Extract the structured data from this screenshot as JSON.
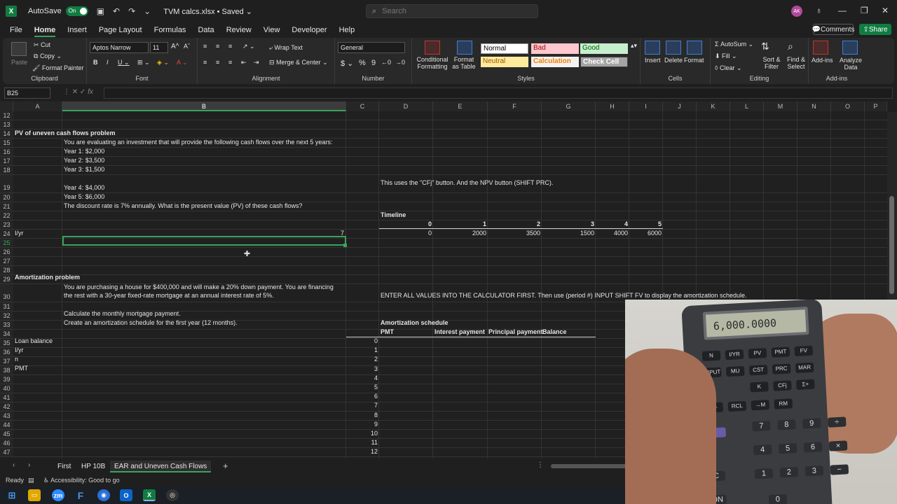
{
  "titlebar": {
    "autosave": "AutoSave",
    "toggle": "On",
    "filename": "TVM calcs.xlsx",
    "saved": "Saved",
    "search_placeholder": "Search",
    "avatar": "AK"
  },
  "menu": [
    "File",
    "Home",
    "Insert",
    "Page Layout",
    "Formulas",
    "Data",
    "Review",
    "View",
    "Developer",
    "Help"
  ],
  "menu_active": "Home",
  "comments": "Comments",
  "share": "Share",
  "ribbon": {
    "clipboard": {
      "label": "Clipboard",
      "paste": "Paste",
      "cut": "Cut",
      "copy": "Copy",
      "format_painter": "Format Painter"
    },
    "font": {
      "label": "Font",
      "family": "Aptos Narrow",
      "size": "11"
    },
    "alignment": {
      "label": "Alignment",
      "wrap": "Wrap Text",
      "merge": "Merge & Center"
    },
    "number": {
      "label": "Number",
      "format": "General"
    },
    "styles": {
      "label": "Styles",
      "cond": "Conditional Formatting",
      "table": "Format as Table",
      "cells": [
        {
          "name": "Normal",
          "bg": "#ffffff",
          "fg": "#000000"
        },
        {
          "name": "Bad",
          "bg": "#ffc7ce",
          "fg": "#9c0006"
        },
        {
          "name": "Good",
          "bg": "#c6efce",
          "fg": "#006100"
        },
        {
          "name": "Neutral",
          "bg": "#ffeb9c",
          "fg": "#9c5700"
        },
        {
          "name": "Calculation",
          "bg": "#f2f2f2",
          "fg": "#fa7d00"
        },
        {
          "name": "Check Cell",
          "bg": "#a5a5a5",
          "fg": "#ffffff"
        }
      ]
    },
    "cells": {
      "label": "Cells",
      "insert": "Insert",
      "delete": "Delete",
      "format": "Format"
    },
    "editing": {
      "label": "Editing",
      "autosum": "AutoSum",
      "fill": "Fill",
      "clear": "Clear",
      "sort": "Sort & Filter",
      "find": "Find & Select"
    },
    "addins": {
      "label": "Add-ins",
      "addins": "Add-ins",
      "analyze": "Analyze Data"
    }
  },
  "namebox": "B25",
  "columns": [
    "A",
    "B",
    "C",
    "D",
    "E",
    "F",
    "G",
    "H",
    "I",
    "J",
    "K",
    "L",
    "M",
    "N",
    "O",
    "P"
  ],
  "rows": [
    "12",
    "13",
    "14",
    "15",
    "16",
    "17",
    "18",
    "19",
    "20",
    "21",
    "22",
    "23",
    "24",
    "25",
    "26",
    "27",
    "28",
    "29",
    "30",
    "31",
    "32",
    "33",
    "34",
    "35",
    "36",
    "37",
    "38",
    "39",
    "40",
    "41",
    "42",
    "43",
    "44",
    "45",
    "46",
    "47"
  ],
  "cells": {
    "r14a": "PV of uneven cash flows problem",
    "r15b": "You are evaluating an investment that will provide the following cash flows over the next 5 years:",
    "r16b": "Year 1: $2,000",
    "r17b": "Year 2: $3,500",
    "r18b": "Year 3: $1,500",
    "r19b": "Year 4: $4,000",
    "r19d": "This uses the \"CFj\" button. And the NPV button (SHIFT PRC).",
    "r20b": "Year 5: $6,000",
    "r21b": "The discount rate is 7% annually. What is the present value (PV) of these cash flows?",
    "r22d": "Timeline",
    "r23_timeline": [
      "0",
      "1",
      "2",
      "3",
      "4",
      "5"
    ],
    "r24a": "I/yr",
    "r24b": "7",
    "r24_cash": [
      "0",
      "2000",
      "3500",
      "1500",
      "4000",
      "6000"
    ],
    "r29a": "Amortization problem",
    "r30b1": "You are purchasing a house for $400,000 and will make a 20% down payment. You are financing",
    "r30b2": "the rest with a 30-year fixed-rate mortgage at an annual interest rate of 5%.",
    "r30d": "ENTER ALL VALUES INTO THE CALCULATOR FIRST. Then use (period #) INPUT SHIFT FV to display the amortization schedule.",
    "r32b": "Calculate the monthly mortgage payment.",
    "r33b": "Create an amortization schedule for the first year (12 months).",
    "r33d": "Amortization schedule",
    "r34d": "PMT",
    "r34e": "Interest payment",
    "r34f": "Principal payment",
    "r34g": "Balance",
    "r35a": "Loan balance",
    "r36a": "I/yr",
    "r37a": "n",
    "r38a": "PMT",
    "schedule_periods": [
      "0",
      "1",
      "2",
      "3",
      "4",
      "5",
      "6",
      "7",
      "8",
      "9",
      "10",
      "11",
      "12"
    ]
  },
  "sheets": [
    "First",
    "HP 10B",
    "EAR and Uneven Cash Flows"
  ],
  "active_sheet": "EAR and Uneven Cash Flows",
  "status": {
    "ready": "Ready",
    "accessibility": "Accessibility: Good to go"
  },
  "calculator": {
    "display": "6,000.0000",
    "keys_row1": [
      "N",
      "I/YR",
      "PV",
      "PMT",
      "FV"
    ],
    "keys_row2": [
      "INPUT",
      "MU",
      "CST",
      "PRC",
      "MAR"
    ],
    "keys_row3": [
      "K",
      "CFj",
      "Σ+"
    ],
    "keys_row4": [
      "+/-",
      "RCL",
      "→M",
      "RM"
    ],
    "digits": [
      "7",
      "8",
      "9",
      "÷",
      "4",
      "5",
      "6",
      "×",
      "1",
      "2",
      "3",
      "−"
    ],
    "c_key": "C",
    "on_key": "ON",
    "zero": "0"
  }
}
